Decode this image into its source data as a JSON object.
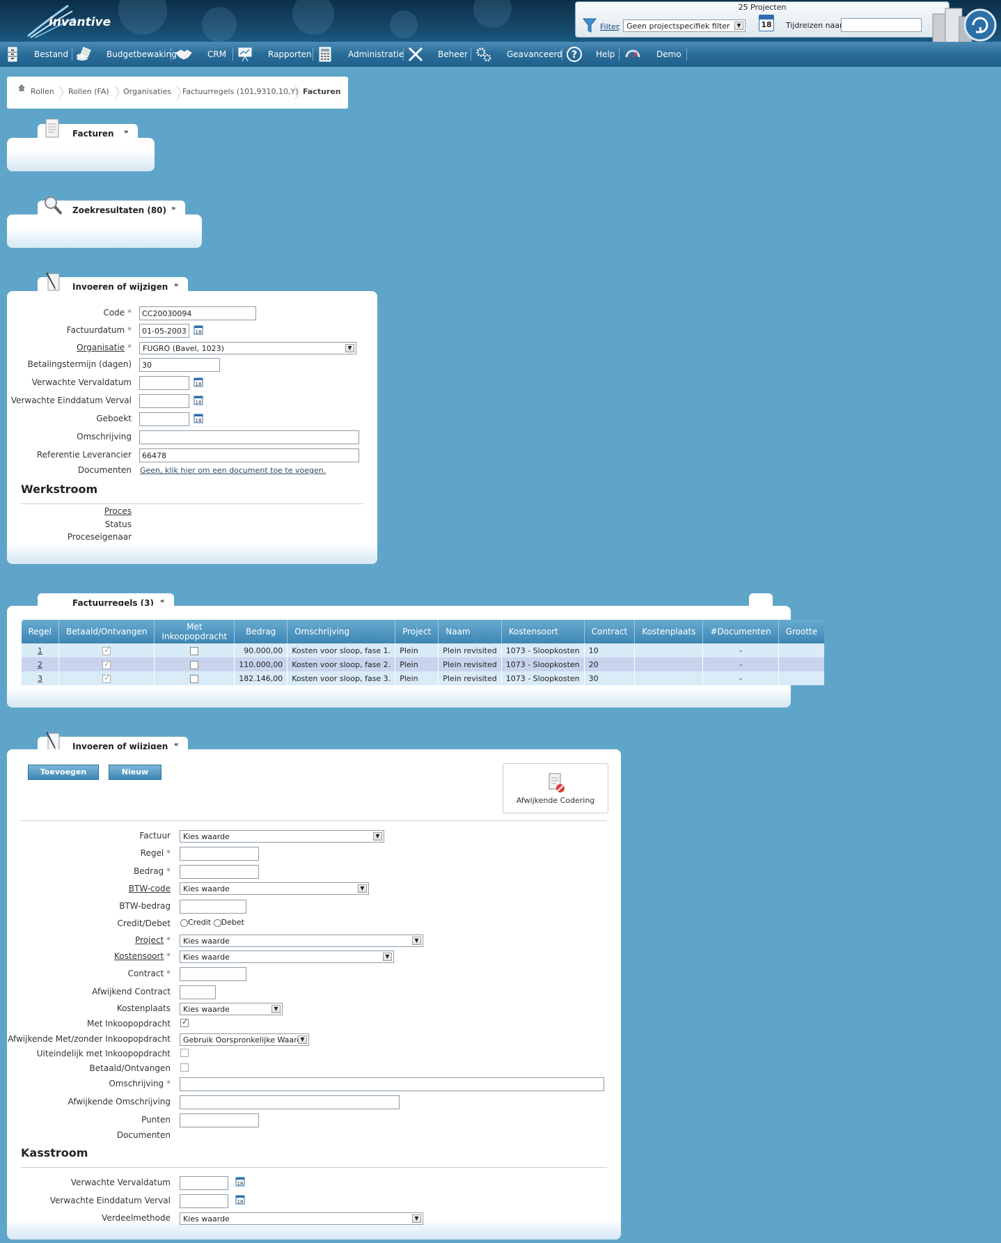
{
  "header": {
    "logo_text": "invantive",
    "project_count": "25 Projecten",
    "filter_link": "Filter",
    "filter_value": "Geen projectspecifiek filter",
    "calendar_day": "18",
    "tijdreizen_label": "Tijdreizen naar:",
    "tijdreizen_value": ""
  },
  "nav": [
    {
      "label": "Bestand",
      "icon": "cabinet-icon"
    },
    {
      "label": "Budgetbewaking",
      "icon": "money-icon"
    },
    {
      "label": "CRM",
      "icon": "handshake-icon"
    },
    {
      "label": "Rapporten",
      "icon": "presentation-icon"
    },
    {
      "label": "Administratie",
      "icon": "calculator-icon"
    },
    {
      "label": "Beheer",
      "icon": "tools-icon"
    },
    {
      "label": "Geavanceerd",
      "icon": "gears-icon"
    },
    {
      "label": "Help",
      "icon": "help-icon"
    },
    {
      "label": "Demo",
      "icon": "demo-icon"
    }
  ],
  "breadcrumb": [
    "Rollen",
    "Rollen (FA)",
    "Organisaties",
    "Factuurregels (101,9310,10,Y)",
    "Facturen"
  ],
  "panels": {
    "facturen": "Facturen",
    "zoekresultaten": "Zoekresultaten (80)",
    "invoeren1": "Invoeren of wijzigen",
    "factuurregels": "Factuurregels (3)",
    "invoeren2": "Invoeren of wijzigen"
  },
  "form1": {
    "code_label": "Code",
    "code_value": "CC20030094",
    "factuurdatum_label": "Factuurdatum",
    "factuurdatum_value": "01-05-2003",
    "organisatie_label": "Organisatie",
    "organisatie_value": "FUGRO (Bavel, 1023)",
    "betalingstermijn_label": "Betalingstermijn (dagen)",
    "betalingstermijn_value": "30",
    "verwachte_vervaldatum_label": "Verwachte Vervaldatum",
    "verwachte_einddatum_label": "Verwachte Einddatum Verval",
    "geboekt_label": "Geboekt",
    "omschrijving_label": "Omschrijving",
    "omschrijving_value": "",
    "referentie_label": "Referentie Leverancier",
    "referentie_value": "66478",
    "documenten_label": "Documenten",
    "documenten_link": "Geen, klik hier om een document toe te voegen.",
    "werkstroom_heading": "Werkstroom",
    "proces_label": "Proces",
    "status_label": "Status",
    "proceseigenaar_label": "Proceseigenaar"
  },
  "grid": {
    "columns": [
      "Regel",
      "Betaald/Ontvangen",
      "Met Inkoopopdracht",
      "Bedrag",
      "Omschrijving",
      "Project",
      "Naam",
      "Kostensoort",
      "Contract",
      "Kostenplaats",
      "#Documenten",
      "Grootte"
    ],
    "rows": [
      {
        "regel": "1",
        "betaald": true,
        "inkoop": false,
        "bedrag": "90.000,00",
        "omschrijving": "Kosten voor sloop, fase 1.",
        "project": "Plein",
        "naam": "Plein revisited",
        "kostensoort": "1073 - Sloopkosten",
        "contract": "10",
        "kostenplaats": "",
        "documenten": "-",
        "grootte": ""
      },
      {
        "regel": "2",
        "betaald": true,
        "inkoop": false,
        "bedrag": "110.000,00",
        "omschrijving": "Kosten voor sloop, fase 2.",
        "project": "Plein",
        "naam": "Plein revisited",
        "kostensoort": "1073 - Sloopkosten",
        "contract": "20",
        "kostenplaats": "",
        "documenten": "-",
        "grootte": ""
      },
      {
        "regel": "3",
        "betaald": true,
        "inkoop": false,
        "bedrag": "182.146,00",
        "omschrijving": "Kosten voor sloop, fase 3.",
        "project": "Plein",
        "naam": "Plein revisited",
        "kostensoort": "1073 - Sloopkosten",
        "contract": "30",
        "kostenplaats": "",
        "documenten": "-",
        "grootte": ""
      }
    ]
  },
  "form2": {
    "toevoegen_button": "Toevoegen",
    "nieuw_button": "Nieuw",
    "afwijkende_codering": "Afwijkende Codering",
    "factuur_label": "Factuur",
    "factuur_value": "Kies waarde",
    "regel_label": "Regel",
    "bedrag_label": "Bedrag",
    "btwcode_label": "BTW-code",
    "btwcode_value": "Kies waarde",
    "btwbedrag_label": "BTW-bedrag",
    "creditdebet_label": "Credit/Debet",
    "credit_option": "Credit",
    "debet_option": "Debet",
    "project_label": "Project",
    "project_value": "Kies waarde",
    "kostensoort_label": "Kostensoort",
    "kostensoort_value": "Kies waarde",
    "contract_label": "Contract",
    "afwijkend_contract_label": "Afwijkend Contract",
    "kostenplaats_label": "Kostenplaats",
    "kostenplaats_value": "Kies waarde",
    "met_inkoop_label": "Met Inkoopopdracht",
    "met_inkoop_checked": true,
    "afwijkende_metzonder_label": "Afwijkende Met/zonder Inkoopopdracht",
    "afwijkende_metzonder_value": "Gebruik Oorspronkelijke Waarde",
    "uiteindelijk_label": "Uiteindelijk met Inkoopopdracht",
    "betaald_label": "Betaald/Ontvangen",
    "omschrijving_label": "Omschrijving",
    "afwijkende_omschrijving_label": "Afwijkende Omschrijving",
    "punten_label": "Punten",
    "documenten_label": "Documenten",
    "kasstroom_heading": "Kasstroom",
    "verwachte_vervaldatum_label": "Verwachte Vervaldatum",
    "verwachte_einddatum_label": "Verwachte Einddatum Verval",
    "verdeelmethode_label": "Verdeelmethode",
    "verdeelmethode_value": "Kies waarde"
  },
  "colors": {
    "background": "#5fa5c9",
    "header_dark": "#0c2f48",
    "grid_header": "#3d86b4"
  }
}
